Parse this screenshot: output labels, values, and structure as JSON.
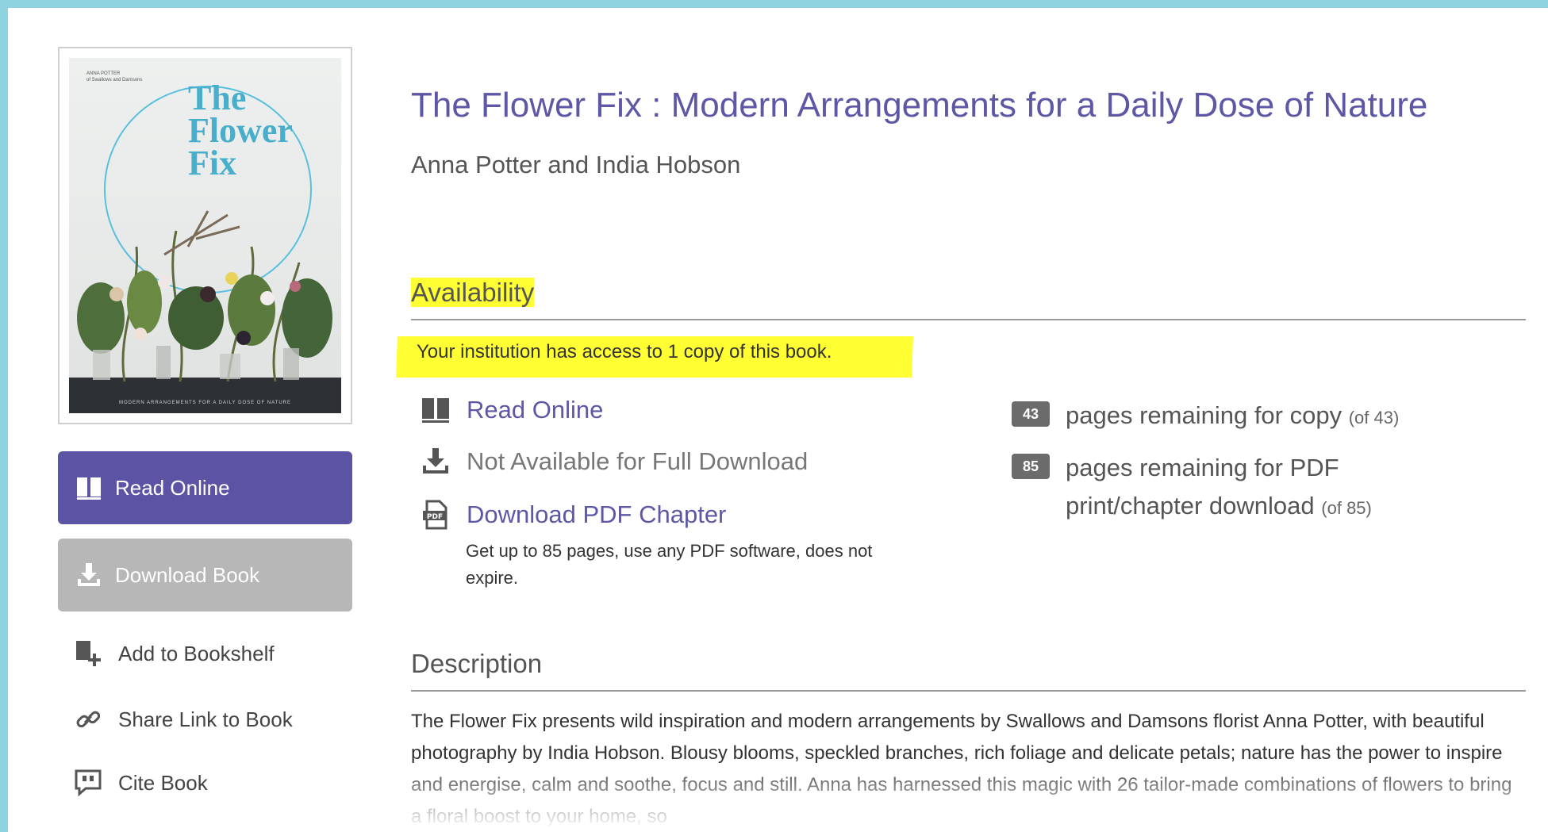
{
  "cover": {
    "byline_line1": "ANNA POTTER",
    "byline_line2": "of Swallows and Damsons",
    "title_line1": "The",
    "title_line2": "Flower",
    "title_line3": "Fix",
    "tagline": "MODERN ARRANGEMENTS FOR A DAILY DOSE OF NATURE",
    "accent_color": "#49aecb"
  },
  "actions": {
    "read_online": "Read Online",
    "download_book": "Download Book",
    "add_to_bookshelf": "Add to Bookshelf",
    "share_link": "Share Link to Book",
    "cite_book": "Cite Book"
  },
  "book": {
    "title": "The Flower Fix : Modern Arrangements for a Daily Dose of Nature",
    "authors": "Anna Potter and India Hobson"
  },
  "availability": {
    "heading": "Availability",
    "note": "Your institution has access to 1 copy of this book.",
    "options": {
      "read_online": "Read Online",
      "full_download": "Not Available for Full Download",
      "pdf_chapter": "Download PDF Chapter",
      "pdf_chapter_note": "Get up to 85 pages, use any PDF software, does not expire."
    },
    "copy": {
      "badge": "43",
      "text": "pages remaining for copy",
      "of": "(of 43)"
    },
    "pdf": {
      "badge": "85",
      "text_line1": "pages remaining for PDF",
      "text_line2": "print/chapter download",
      "of": "(of 85)"
    }
  },
  "description": {
    "heading": "Description",
    "text": "The Flower Fix presents wild inspiration and modern arrangements by Swallows and Damsons florist Anna Potter, with beautiful photography by India Hobson. Blousy blooms, speckled branches, rich foliage and delicate petals; nature has the power to inspire and energise, calm and soothe, focus and still. Anna has harnessed this magic with 26 tailor-made combinations of flowers to bring a floral boost to your home, so"
  },
  "colors": {
    "brand_purple": "#5b54a5",
    "disabled_gray": "#b7b7b7",
    "highlight_yellow": "#ffff33",
    "frame_blue": "#8fd3e0"
  }
}
